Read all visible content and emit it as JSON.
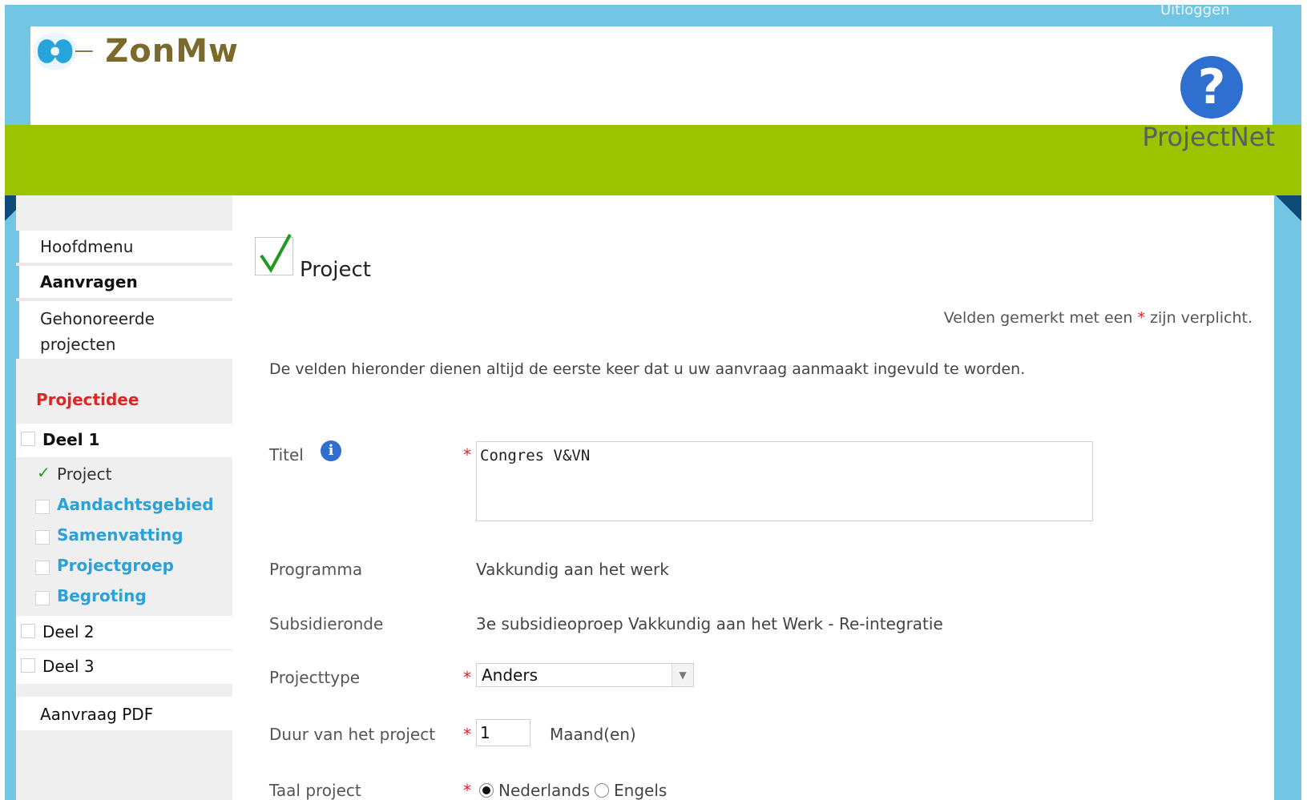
{
  "header": {
    "logout": "Uitloggen",
    "logo_text": "ZonMw",
    "help_glyph": "?",
    "app_name": "ProjectNet"
  },
  "sidebar": {
    "items": [
      {
        "label": "Hoofdmenu"
      },
      {
        "label": "Aanvragen"
      },
      {
        "label": "Gehonoreerde projecten"
      }
    ],
    "section_title": "Projectidee",
    "deel1": "Deel 1",
    "subitems": [
      {
        "label": "Project"
      },
      {
        "label": "Aandachtsgebied"
      },
      {
        "label": "Samenvatting"
      },
      {
        "label": "Projectgroep"
      },
      {
        "label": "Begroting"
      }
    ],
    "deel2": "Deel 2",
    "deel3": "Deel 3",
    "pdf": "Aanvraag PDF"
  },
  "main": {
    "title": "Project",
    "required_note_pre": "Velden gemerkt met een",
    "required_star": "*",
    "required_note_post": "zijn verplicht.",
    "intro": "De velden hieronder dienen altijd de eerste keer dat u uw aanvraag aanmaakt ingevuld te worden.",
    "fields": {
      "titel_label": "Titel",
      "info_glyph": "i",
      "titel_value": "Congres V&VN",
      "programma_label": "Programma",
      "programma_value": "Vakkundig aan het werk",
      "subsidieronde_label": "Subsidieronde",
      "subsidieronde_value": "3e subsidieoproep Vakkundig aan het Werk - Re-integratie",
      "projecttype_label": "Projecttype",
      "projecttype_value": "Anders",
      "duur_label": "Duur van het project",
      "duur_value": "1",
      "duur_unit": "Maand(en)",
      "taal_label": "Taal project",
      "taal_option1": "Nederlands",
      "taal_option2": "Engels"
    }
  },
  "colors": {
    "sky": "#72c6e3",
    "green_band": "#9cc200",
    "required": "#e32323",
    "link": "#2aa1d8",
    "help": "#2f6fcf"
  },
  "icons": {
    "help": "help-icon",
    "info": "info-icon",
    "check": "check-icon",
    "select_arrow": "chevron-down-icon"
  }
}
